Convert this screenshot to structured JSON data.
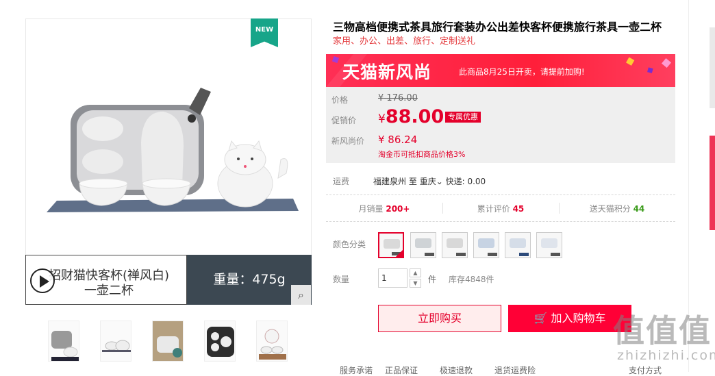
{
  "gallery": {
    "new_badge": "NEW",
    "caption": "招财猫快客杯(禅风白)\n一壶二杯",
    "weight": "重量：475g",
    "zoom_icon": "search-icon",
    "play_icon": "play-icon",
    "thumbnails": [
      "thumb-1",
      "thumb-2",
      "thumb-3",
      "thumb-4",
      "thumb-5"
    ]
  },
  "product": {
    "title": "三物高档便携式茶具旅行套装办公出差快客杯便携旅行茶具一壶二杯",
    "subtitle": "家用、办公、出差、旅行、定制送礼"
  },
  "promo": {
    "logo_text": "天猫新风尚",
    "notice": "此商品8月25日开卖，请提前加购!",
    "colors": {
      "banner": "#ff1f3a"
    }
  },
  "price": {
    "list_label": "价格",
    "list_currency": "¥",
    "list_value": "176.00",
    "sale_label": "促销价",
    "sale_currency": "¥",
    "sale_value": "88.00",
    "sale_tag": "专属优惠",
    "fashion_label": "新风尚价",
    "fashion_value": "¥ 86.24",
    "coin_note": "淘金币可抵扣商品价格3%",
    "accent": "#e4002b"
  },
  "shipping": {
    "label": "运费",
    "from": "福建泉州",
    "to_word": "至",
    "to": "重庆",
    "fee": "快递: 0.00"
  },
  "stats": {
    "monthly_label": "月销量",
    "monthly_value": "200+",
    "reviews_label": "累计评价",
    "reviews_value": "45",
    "points_label": "送天猫积分",
    "points_value": "44"
  },
  "options": {
    "color_label": "颜色分类",
    "swatches": [
      "款式1",
      "款式2",
      "款式3",
      "款式4",
      "款式5",
      "款式6"
    ],
    "selected_index": 0
  },
  "quantity": {
    "label": "数量",
    "value": "1",
    "unit": "件",
    "stock": "库存4848件"
  },
  "actions": {
    "buy_now": "立即购买",
    "add_to_cart": "加入购物车"
  },
  "services": [
    "服务承诺",
    "正品保证",
    "极速退款",
    "退货运费险",
    "支付方式"
  ],
  "watermark": {
    "big": "值值值",
    "small": "zhizhizhi.com"
  }
}
